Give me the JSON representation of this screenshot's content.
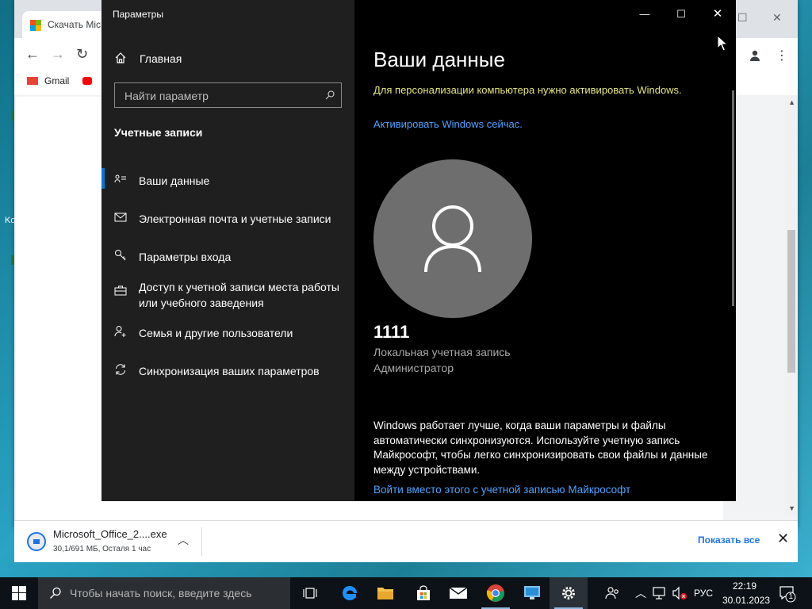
{
  "desktop": {
    "fragments": [
      "Ko"
    ]
  },
  "chrome": {
    "tab_title": "Скачать Mic",
    "bookmarks": {
      "gmail": "Gmail"
    },
    "download": {
      "file_name": "Microsoft_Office_2....exe",
      "status": "30,1/691 МБ, Осталя 1 час",
      "show_all": "Показать все"
    }
  },
  "settings": {
    "window_title": "Параметры",
    "sidebar": {
      "home": "Главная",
      "search_placeholder": "Найти параметр",
      "section": "Учетные записи",
      "items": [
        {
          "label": "Ваши данные",
          "icon": "person-card-icon",
          "active": true
        },
        {
          "label": "Электронная почта и учетные записи",
          "icon": "mail-icon",
          "active": false
        },
        {
          "label": "Параметры входа",
          "icon": "key-icon",
          "active": false
        },
        {
          "label": "Доступ к учетной записи места работы или учебного заведения",
          "icon": "briefcase-icon",
          "active": false
        },
        {
          "label": "Семья и другие пользователи",
          "icon": "person-add-icon",
          "active": false
        },
        {
          "label": "Синхронизация ваших параметров",
          "icon": "sync-icon",
          "active": false
        }
      ]
    },
    "main": {
      "title": "Ваши данные",
      "activation_warning": "Для персонализации компьютера нужно активировать Windows.",
      "activation_link": "Активировать Windows сейчас.",
      "user_name": "1111",
      "account_type": "Локальная учетная запись",
      "account_role": "Администратор",
      "sync_text": "Windows работает лучше, когда ваши параметры и файлы автоматически синхронизуются. Используйте учетную запись Майкрософт, чтобы легко синхронизировать свои файлы и данные между устройствами.",
      "ms_account_link": "Войти вместо этого с учетной записью Майкрософт"
    }
  },
  "taskbar": {
    "search_placeholder": "Чтобы начать поиск, введите здесь",
    "apps": [
      "task-view",
      "edge",
      "file-explorer",
      "store",
      "mail",
      "chrome",
      "remote-desktop",
      "settings"
    ],
    "language": "РУС",
    "time": "22:19",
    "date": "30.01.2023",
    "notification_count": "1"
  },
  "colors": {
    "accent": "#0078d7",
    "warning": "#e6e67a",
    "link": "#4da3ff"
  }
}
